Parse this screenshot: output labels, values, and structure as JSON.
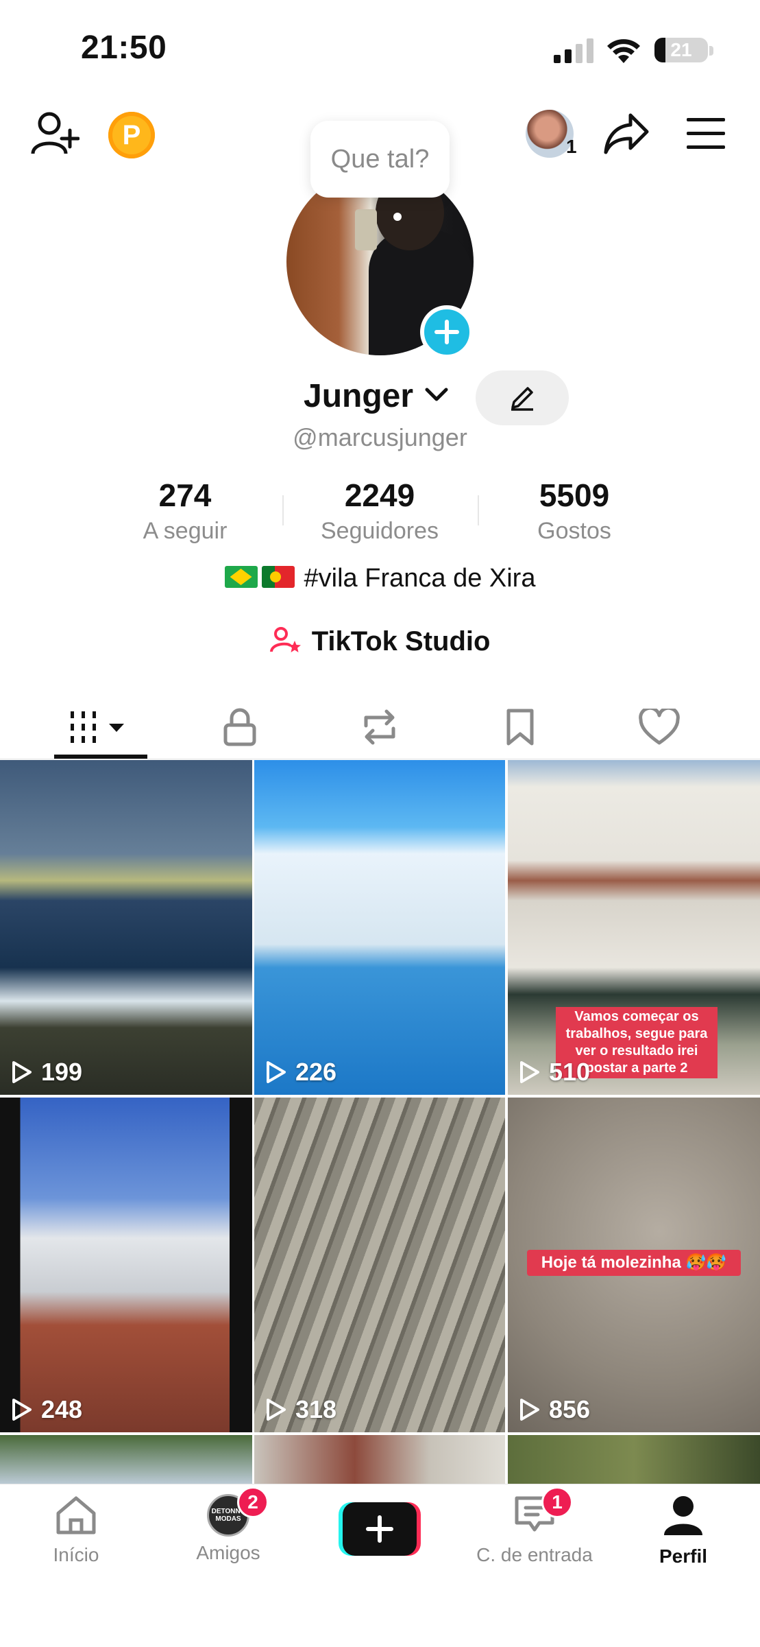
{
  "status_bar": {
    "time": "21:50",
    "battery": "21",
    "battery_level": 0.21
  },
  "header": {
    "coin_letter": "P",
    "switch_account_count": "1",
    "tooltip": "Que tal?"
  },
  "profile": {
    "name": "Junger",
    "handle": "@marcusjunger",
    "stats": [
      {
        "value": "274",
        "label": "A seguir"
      },
      {
        "value": "2249",
        "label": "Seguidores"
      },
      {
        "value": "5509",
        "label": "Gostos"
      }
    ],
    "bio": "#vila Franca de Xira",
    "studio_label": "TikTok Studio"
  },
  "grid": {
    "videos": [
      {
        "views": "199"
      },
      {
        "views": "226"
      },
      {
        "views": "510",
        "caption": "Vamos começar os trabalhos, segue para ver o resultado irei postar a parte 2"
      },
      {
        "views": "248"
      },
      {
        "views": "318"
      },
      {
        "views": "856",
        "caption": "Hoje tá molezinha 🥵🥵"
      }
    ]
  },
  "bottom_nav": {
    "items": [
      {
        "label": "Início"
      },
      {
        "label": "Amigos",
        "badge": "2"
      },
      {
        "label": "C. de entrada",
        "badge": "1"
      },
      {
        "label": "Perfil"
      }
    ],
    "friends_avatar_text": "DETONNY MODAS"
  },
  "colors": {
    "accent": "#fe2c55",
    "cyan": "#25f4ee",
    "badge": "#1fbde3",
    "coin": "#ffb71b"
  }
}
